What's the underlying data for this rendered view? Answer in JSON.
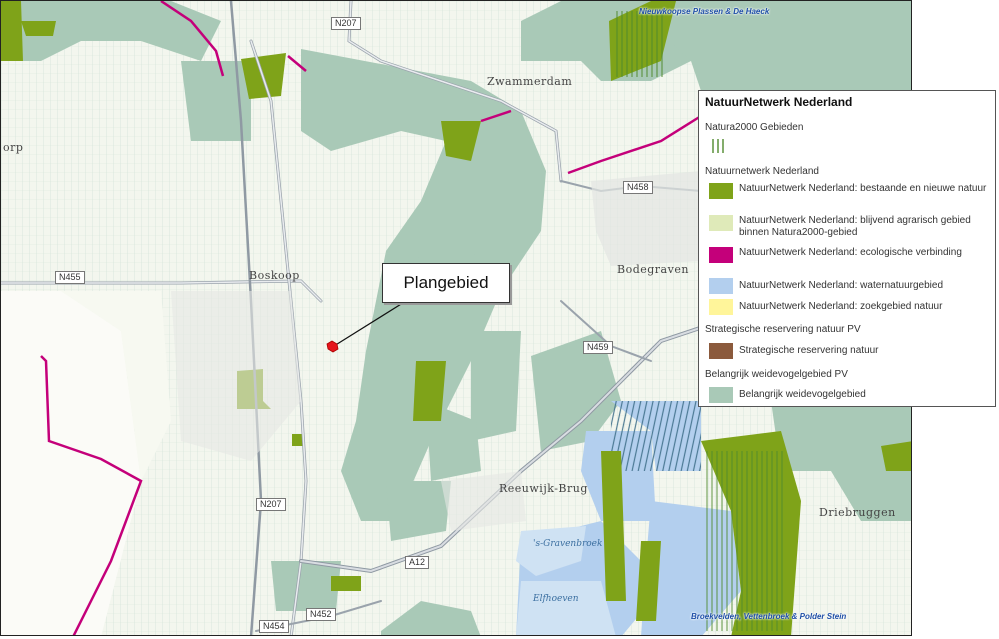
{
  "map": {
    "places": {
      "zwammerdam": "Zwammerdam",
      "boskoop": "Boskoop",
      "bodegraven": "Bodegraven",
      "reeuwijk_brug": "Reeuwijk-Brug",
      "driebruggen": "Driebruggen",
      "orp": "orp"
    },
    "water_labels": {
      "gravenbroek": "'s-Gravenbroek",
      "elfhoeven": "Elfhoeven"
    },
    "roads": {
      "n207_top": "N207",
      "n455": "N455",
      "n458": "N458",
      "n459": "N459",
      "n207_bottom": "N207",
      "a12": "A12",
      "n452": "N452",
      "n454": "N454"
    },
    "area_names": {
      "nieuwkoopse": "Nieuwkoopse Plassen & De Haeck",
      "broekvelden": "Broekvelden, Vettenbroek & Polder Stein"
    },
    "callout_text": "Plangebied",
    "colors": {
      "background": "#f3f6ee",
      "weidevogel": "#a9c9b7",
      "bestaande_natuur": "#7fa319",
      "agrarisch": "#dfeab9",
      "ecologische_verbinding": "#c4007a",
      "waternatuur": "#b3cfee",
      "zoekgebied": "#fff59a",
      "strategische_reservering": "#8b5a3c",
      "natura2000_hatch": "#4e8a2c",
      "marker": "#e5141c"
    }
  },
  "legend": {
    "title": "NatuurNetwerk Nederland",
    "groups": [
      {
        "heading": "Natura2000 Gebieden",
        "items": [
          {
            "label": "",
            "swatch": "natura2000-hatch"
          }
        ]
      },
      {
        "heading": "Natuurnetwerk Nederland",
        "items": [
          {
            "label": "NatuurNetwerk Nederland: bestaande en nieuwe natuur",
            "swatch": "#7fa319"
          },
          {
            "label": "NatuurNetwerk Nederland: blijvend agrarisch gebied binnen Natura2000-gebied",
            "swatch": "#dfeab9"
          },
          {
            "label": "NatuurNetwerk Nederland: ecologische verbinding",
            "swatch": "#c4007a"
          },
          {
            "label": "NatuurNetwerk Nederland: waternatuurgebied",
            "swatch": "#b3cfee"
          },
          {
            "label": "NatuurNetwerk Nederland: zoekgebied natuur",
            "swatch": "#fff59a"
          }
        ]
      },
      {
        "heading": "Strategische reservering natuur PV",
        "items": [
          {
            "label": "Strategische reservering natuur",
            "swatch": "#8b5a3c"
          }
        ]
      },
      {
        "heading": "Belangrijk weidevogelgebied PV",
        "items": [
          {
            "label": "Belangrijk weidevogelgebied",
            "swatch": "#a9c9b7"
          }
        ]
      }
    ]
  }
}
